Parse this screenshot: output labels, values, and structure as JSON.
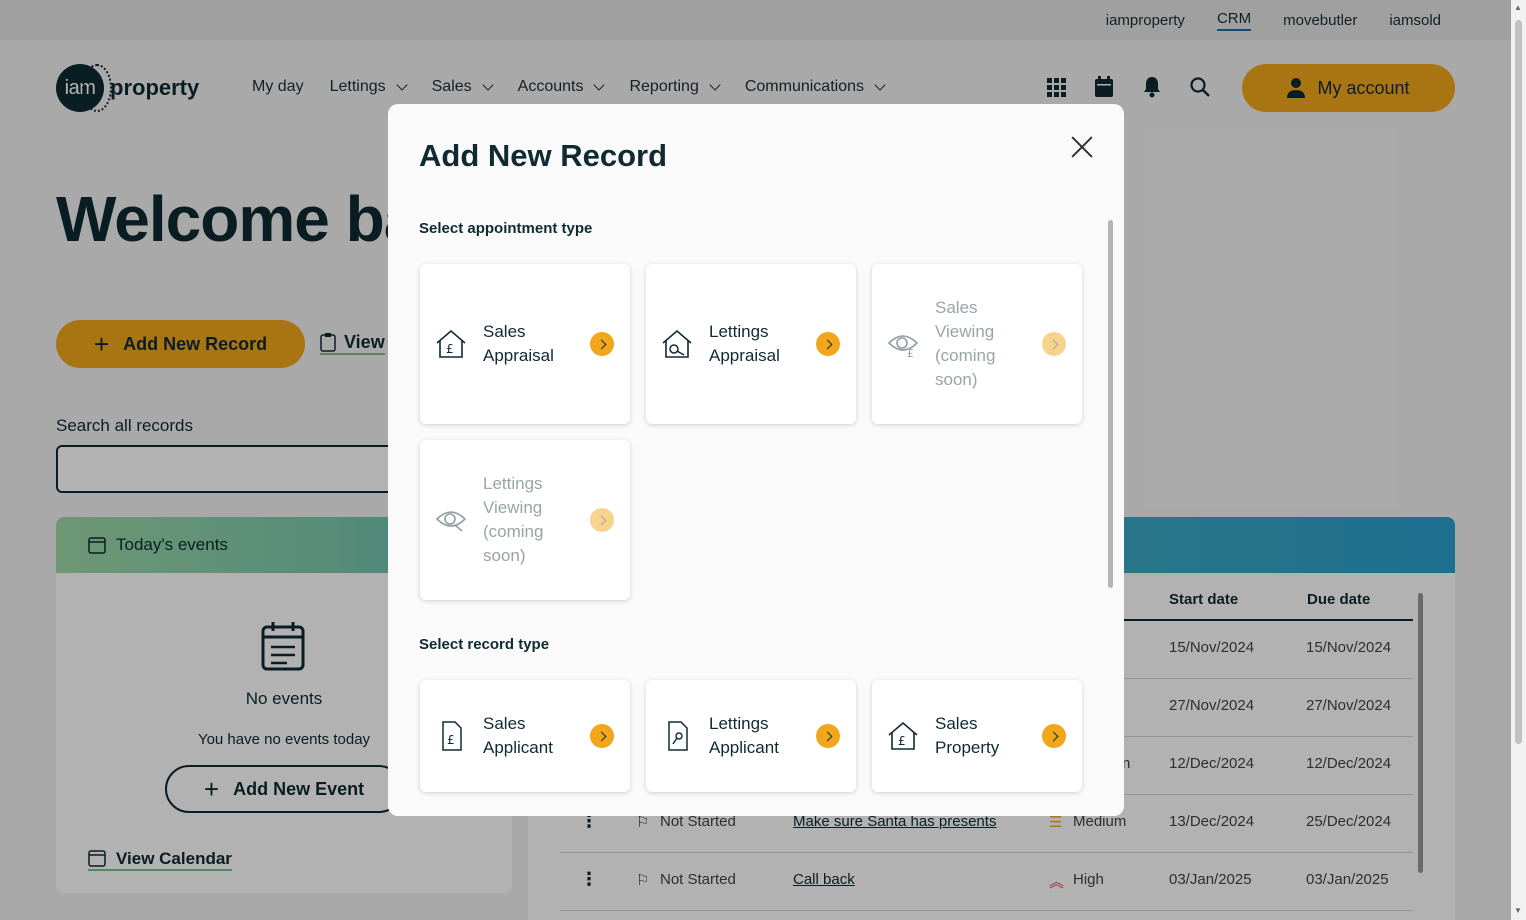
{
  "topbar": {
    "links": [
      "iamproperty",
      "CRM",
      "movebutler",
      "iamsold"
    ]
  },
  "header": {
    "logo_mark": "iam",
    "logo_word": "property",
    "nav": [
      "My day",
      "Lettings",
      "Sales",
      "Accounts",
      "Reporting",
      "Communications"
    ],
    "icons": [
      "apps-grid-icon",
      "calendar-icon",
      "bell-icon",
      "search-icon"
    ],
    "account_label": "My account"
  },
  "page": {
    "welcome": "Welcome ba",
    "add_record_label": "Add New Record",
    "view_label": "View",
    "search_label": "Search all records",
    "search_value": ""
  },
  "events": {
    "title": "Today's events",
    "no_events": "No events",
    "no_events_sub": "You have no events today",
    "add_event_label": "Add New Event",
    "view_calendar_label": "View Calendar"
  },
  "tasks": {
    "headers": {
      "start": "Start date",
      "due": "Due date"
    },
    "rows": [
      {
        "status": "",
        "task": "",
        "priority": "",
        "start": "15/Nov/2024",
        "due": "15/Nov/2024"
      },
      {
        "status": "",
        "task": "",
        "priority": "",
        "start": "27/Nov/2024",
        "due": "27/Nov/2024"
      },
      {
        "status": "",
        "task": "",
        "priority": "n",
        "start": "12/Dec/2024",
        "due": "12/Dec/2024"
      },
      {
        "status": "Not Started",
        "task": "Make sure Santa has presents",
        "priority": "Medium",
        "start": "13/Dec/2024",
        "due": "25/Dec/2024"
      },
      {
        "status": "Not Started",
        "task": "Call back",
        "priority": "High",
        "start": "03/Jan/2025",
        "due": "03/Jan/2025"
      }
    ]
  },
  "modal": {
    "title": "Add New Record",
    "appointment_section": "Select appointment type",
    "record_section": "Select record type",
    "appointment_types": [
      {
        "label": "Sales Appraisal",
        "icon": "house-pound-icon",
        "enabled": true
      },
      {
        "label": "Lettings Appraisal",
        "icon": "house-key-icon",
        "enabled": true
      },
      {
        "label": "Sales Viewing (coming soon)",
        "icon": "eye-pound-icon",
        "enabled": false
      },
      {
        "label": "Lettings Viewing (coming soon)",
        "icon": "eye-key-icon",
        "enabled": false
      }
    ],
    "record_types": [
      {
        "label": "Sales Applicant",
        "icon": "document-pound-icon",
        "enabled": true
      },
      {
        "label": "Lettings Applicant",
        "icon": "document-key-icon",
        "enabled": true
      },
      {
        "label": "Sales Property",
        "icon": "house-pound-icon",
        "enabled": true
      }
    ]
  },
  "colors": {
    "accent": "#f2a71b",
    "ink": "#0f2a33",
    "link_underline": "#7cc28d"
  }
}
